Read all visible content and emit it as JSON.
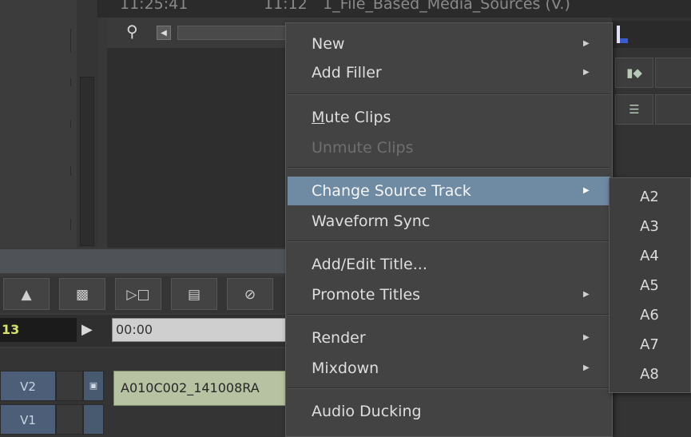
{
  "source_header": {
    "timecode": "11:25:41",
    "duration": "11:12",
    "title": "1_File_Based_Media_Sources (V.)"
  },
  "timeline": {
    "timecode_value": "13",
    "position_input": "00:00",
    "tracks": [
      {
        "name": "V2"
      },
      {
        "name": "V1"
      }
    ],
    "clip_name": "A010C002_141008RA"
  },
  "context_menu": {
    "items": [
      {
        "label": "New",
        "has_submenu": true,
        "disabled": false
      },
      {
        "label": "Add Filler",
        "has_submenu": true,
        "disabled": false
      },
      {
        "label": "Mute Clips",
        "has_submenu": false,
        "disabled": false
      },
      {
        "label": "Unmute Clips",
        "has_submenu": false,
        "disabled": true
      },
      {
        "label": "Change Source Track",
        "has_submenu": true,
        "disabled": false,
        "highlighted": true
      },
      {
        "label": "Waveform Sync",
        "has_submenu": false,
        "disabled": false
      },
      {
        "label": "Add/Edit Title...",
        "has_submenu": false,
        "disabled": false
      },
      {
        "label": "Promote Titles",
        "has_submenu": true,
        "disabled": false
      },
      {
        "label": "Render",
        "has_submenu": true,
        "disabled": false
      },
      {
        "label": "Mixdown",
        "has_submenu": true,
        "disabled": false
      },
      {
        "label": "Audio Ducking",
        "has_submenu": false,
        "disabled": false
      }
    ]
  },
  "source_track_submenu": {
    "items": [
      "A2",
      "A3",
      "A4",
      "A5",
      "A6",
      "A7",
      "A8"
    ]
  },
  "colors": {
    "menu_bg": "#434343",
    "highlight": "#6f8aa3",
    "track_label": "#4d5f78",
    "clip": "#b7c2a2",
    "timecode_text": "#d8e36a"
  },
  "icons": {
    "search": "magnifier",
    "submenu_arrow": "triangle-right"
  }
}
